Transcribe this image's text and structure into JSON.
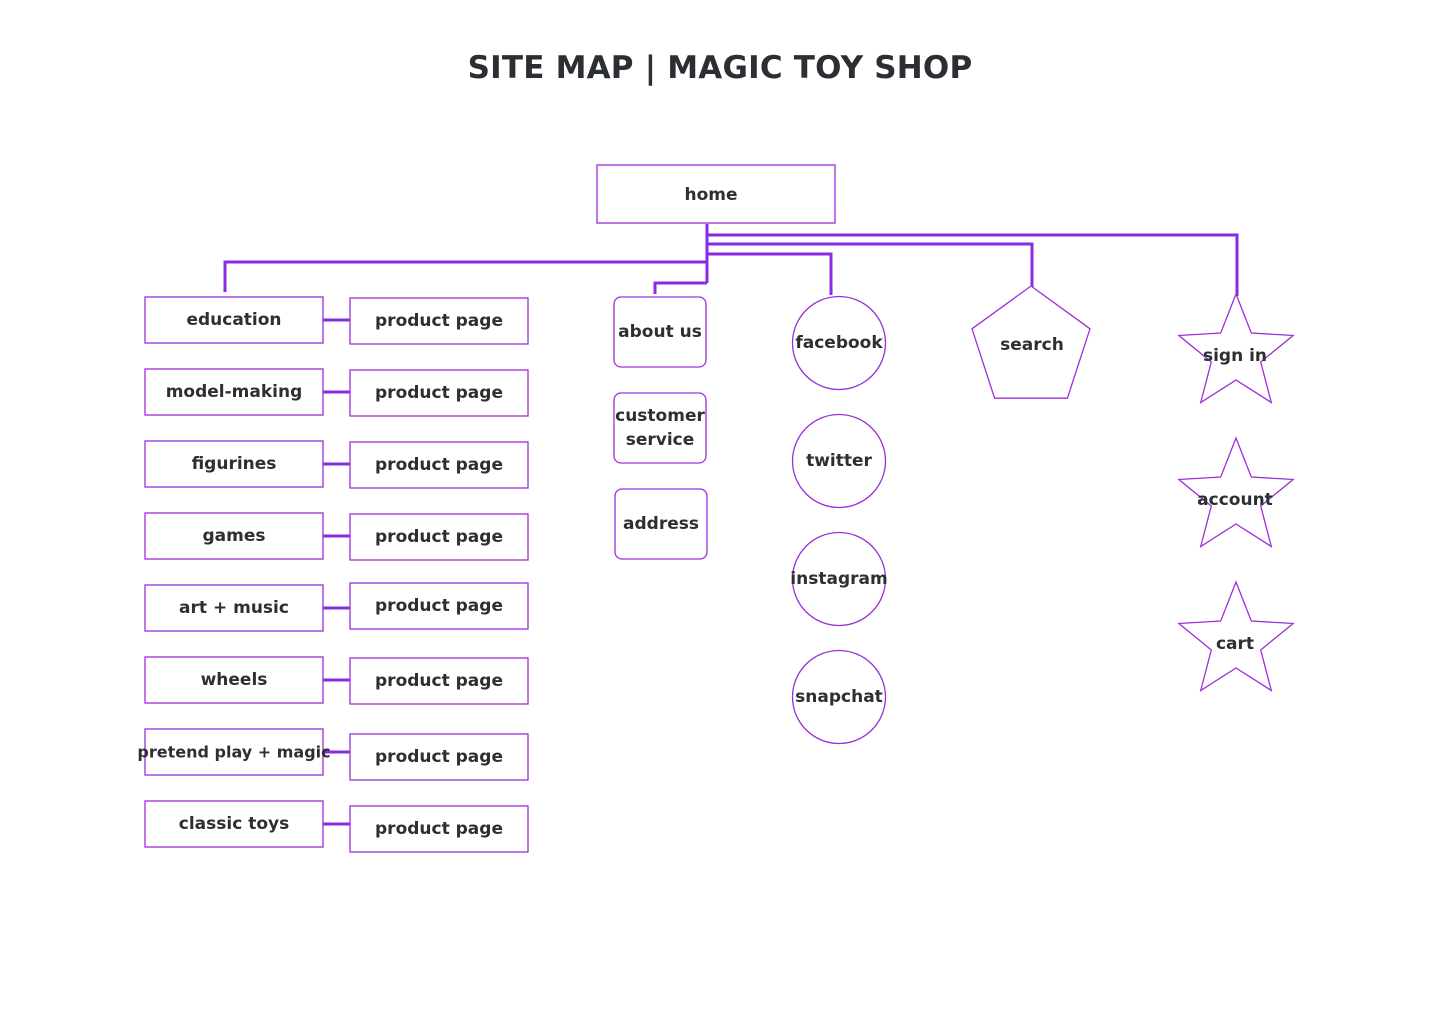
{
  "title": "SITE MAP | MAGIC TOY SHOP",
  "colors": {
    "connector": "#8a2be2",
    "node_stroke": "#9b30d9",
    "text": "#2d3033"
  },
  "nodes": {
    "home": "home",
    "categories": [
      "education",
      "model-making",
      "figurines",
      "games",
      "art + music",
      "wheels",
      "pretend play + magic",
      "classic toys"
    ],
    "product_page": "product page",
    "info_pages": [
      [
        "about us"
      ],
      [
        "customer",
        "service"
      ],
      [
        "address"
      ]
    ],
    "social": [
      "facebook",
      "twitter",
      "instagram",
      "snapchat"
    ],
    "search": "search",
    "account_links": [
      "sign in",
      "account",
      "cart"
    ]
  }
}
